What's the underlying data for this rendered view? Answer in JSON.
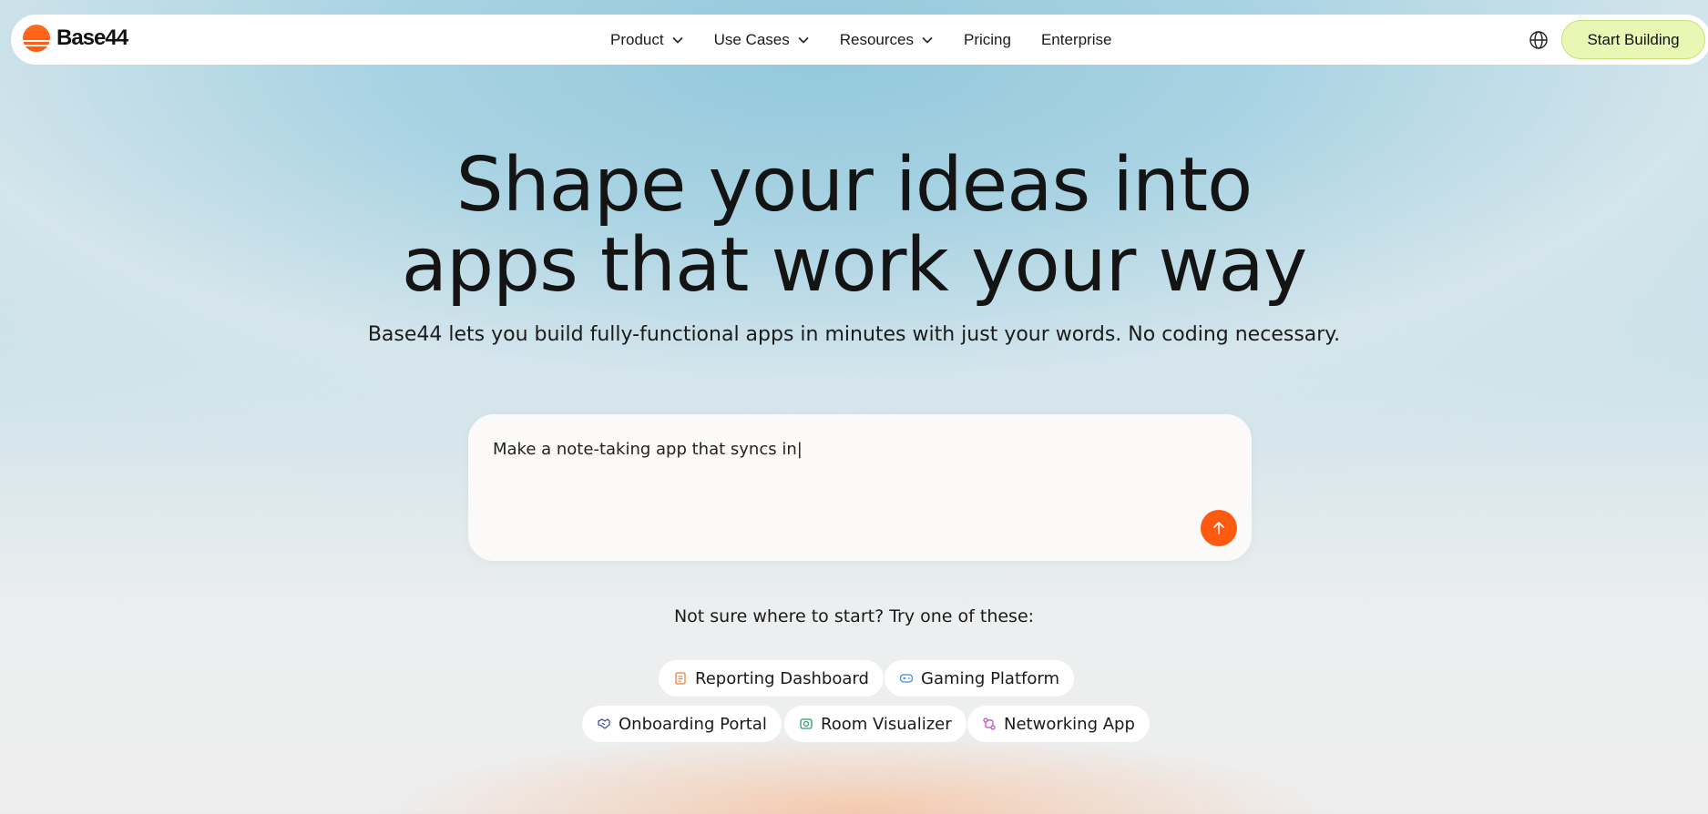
{
  "brand": {
    "name": "Base44",
    "logo_color": "#ff5a10"
  },
  "nav": {
    "items": [
      {
        "label": "Product",
        "has_dropdown": true
      },
      {
        "label": "Use Cases",
        "has_dropdown": true
      },
      {
        "label": "Resources",
        "has_dropdown": true
      },
      {
        "label": "Pricing",
        "has_dropdown": false
      },
      {
        "label": "Enterprise",
        "has_dropdown": false
      }
    ],
    "language_icon": "globe-icon",
    "cta_label": "Start Building",
    "cta_color": "#e8f7b4"
  },
  "hero": {
    "title_line1": "Shape your ideas into",
    "title_line2": "apps that work your way",
    "subtitle": "Base44 lets you build fully-functional apps in minutes with just your words. No coding necessary."
  },
  "prompt": {
    "value": "Make a note-taking app that syncs in|",
    "send_icon": "arrow-up-icon",
    "send_color": "#ff5a10"
  },
  "suggestions": {
    "label": "Not sure where to start? Try one of these:",
    "chips": [
      {
        "label": "Reporting Dashboard",
        "icon": "report-icon",
        "icon_color": "#e8843a"
      },
      {
        "label": "Gaming Platform",
        "icon": "gamepad-icon",
        "icon_color": "#3b8fd6"
      },
      {
        "label": "Onboarding Portal",
        "icon": "handshake-icon",
        "icon_color": "#4a4aa8"
      },
      {
        "label": "Room Visualizer",
        "icon": "room-icon",
        "icon_color": "#2f9a6a"
      },
      {
        "label": "Networking App",
        "icon": "network-icon",
        "icon_color": "#c04ac0"
      }
    ]
  }
}
